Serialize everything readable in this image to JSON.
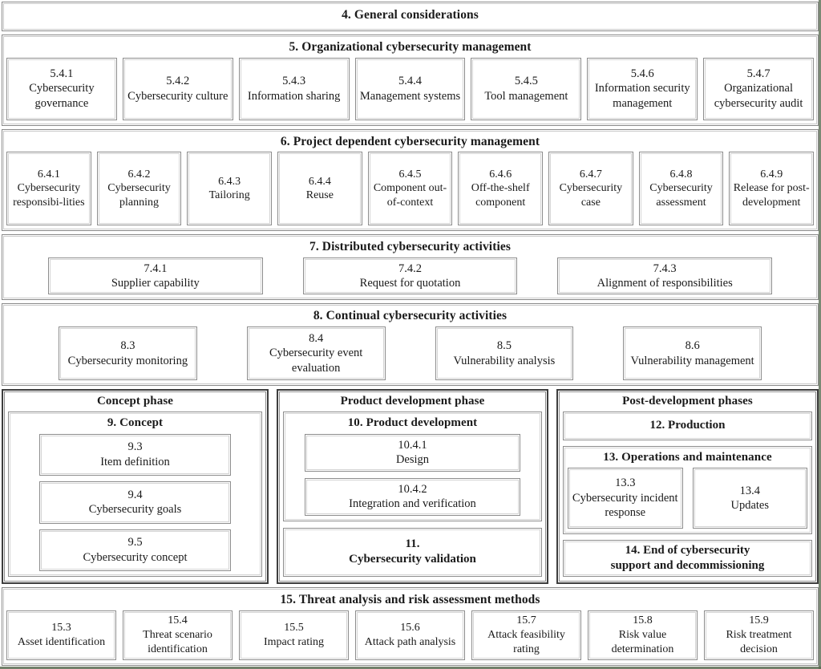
{
  "sections": {
    "s4": {
      "title": "4. General considerations"
    },
    "s5": {
      "title": "5. Organizational cybersecurity management",
      "items": [
        {
          "num": "5.4.1",
          "label": "Cybersecurity governance"
        },
        {
          "num": "5.4.2",
          "label": "Cybersecurity culture"
        },
        {
          "num": "5.4.3",
          "label": "Information sharing"
        },
        {
          "num": "5.4.4",
          "label": "Management systems"
        },
        {
          "num": "5.4.5",
          "label": "Tool management"
        },
        {
          "num": "5.4.6",
          "label": "Information security management"
        },
        {
          "num": "5.4.7",
          "label": "Organizational cybersecurity audit"
        }
      ]
    },
    "s6": {
      "title": "6. Project dependent cybersecurity management",
      "items": [
        {
          "num": "6.4.1",
          "label": "Cybersecurity responsibi-lities"
        },
        {
          "num": "6.4.2",
          "label": "Cybersecurity planning"
        },
        {
          "num": "6.4.3",
          "label": "Tailoring"
        },
        {
          "num": "6.4.4",
          "label": "Reuse"
        },
        {
          "num": "6.4.5",
          "label": "Component out-of-context"
        },
        {
          "num": "6.4.6",
          "label": "Off-the-shelf component"
        },
        {
          "num": "6.4.7",
          "label": "Cybersecurity case"
        },
        {
          "num": "6.4.8",
          "label": "Cybersecurity assessment"
        },
        {
          "num": "6.4.9",
          "label": "Release for post-development"
        }
      ]
    },
    "s7": {
      "title": "7. Distributed cybersecurity activities",
      "items": [
        {
          "num": "7.4.1",
          "label": "Supplier capability"
        },
        {
          "num": "7.4.2",
          "label": "Request for quotation"
        },
        {
          "num": "7.4.3",
          "label": "Alignment of responsibilities"
        }
      ]
    },
    "s8": {
      "title": "8. Continual cybersecurity activities",
      "items": [
        {
          "num": "8.3",
          "label": "Cybersecurity monitoring"
        },
        {
          "num": "8.4",
          "label": "Cybersecurity event evaluation"
        },
        {
          "num": "8.5",
          "label": "Vulnerability analysis"
        },
        {
          "num": "8.6",
          "label": "Vulnerability management"
        }
      ]
    },
    "s15": {
      "title": "15. Threat analysis and risk assessment methods",
      "items": [
        {
          "num": "15.3",
          "label": "Asset identification"
        },
        {
          "num": "15.4",
          "label": "Threat scenario identification"
        },
        {
          "num": "15.5",
          "label": "Impact rating"
        },
        {
          "num": "15.6",
          "label": "Attack path analysis"
        },
        {
          "num": "15.7",
          "label": "Attack feasibility rating"
        },
        {
          "num": "15.8",
          "label": "Risk value determination"
        },
        {
          "num": "15.9",
          "label": "Risk treatment decision"
        }
      ]
    }
  },
  "phases": {
    "concept": {
      "title": "Concept phase",
      "group": {
        "title": "9. Concept",
        "items": [
          {
            "num": "9.3",
            "label": "Item definition"
          },
          {
            "num": "9.4",
            "label": "Cybersecurity goals"
          },
          {
            "num": "9.5",
            "label": "Cybersecurity concept"
          }
        ]
      }
    },
    "product": {
      "title": "Product development phase",
      "group": {
        "title": "10. Product development",
        "items": [
          {
            "num": "10.4.1",
            "label": "Design"
          },
          {
            "num": "10.4.2",
            "label": "Integration and verification"
          }
        ]
      },
      "validation": {
        "num": "11.",
        "label": "Cybersecurity validation"
      }
    },
    "post": {
      "title": "Post-development phases",
      "production": {
        "label": "12. Production"
      },
      "operations": {
        "title": "13. Operations and maintenance",
        "items": [
          {
            "num": "13.3",
            "label": "Cybersecurity incident response"
          },
          {
            "num": "13.4",
            "label": "Updates"
          }
        ]
      },
      "end_of_support": {
        "line1": "14. End of cybersecurity",
        "line2": "support and decommissioning"
      }
    }
  },
  "colors": {
    "box_border": "#8d8d8d",
    "heavy_border": "#3d3d3d",
    "page_edge": "#5a6b52",
    "background": "#ffffff",
    "text": "#1a1a1a"
  }
}
